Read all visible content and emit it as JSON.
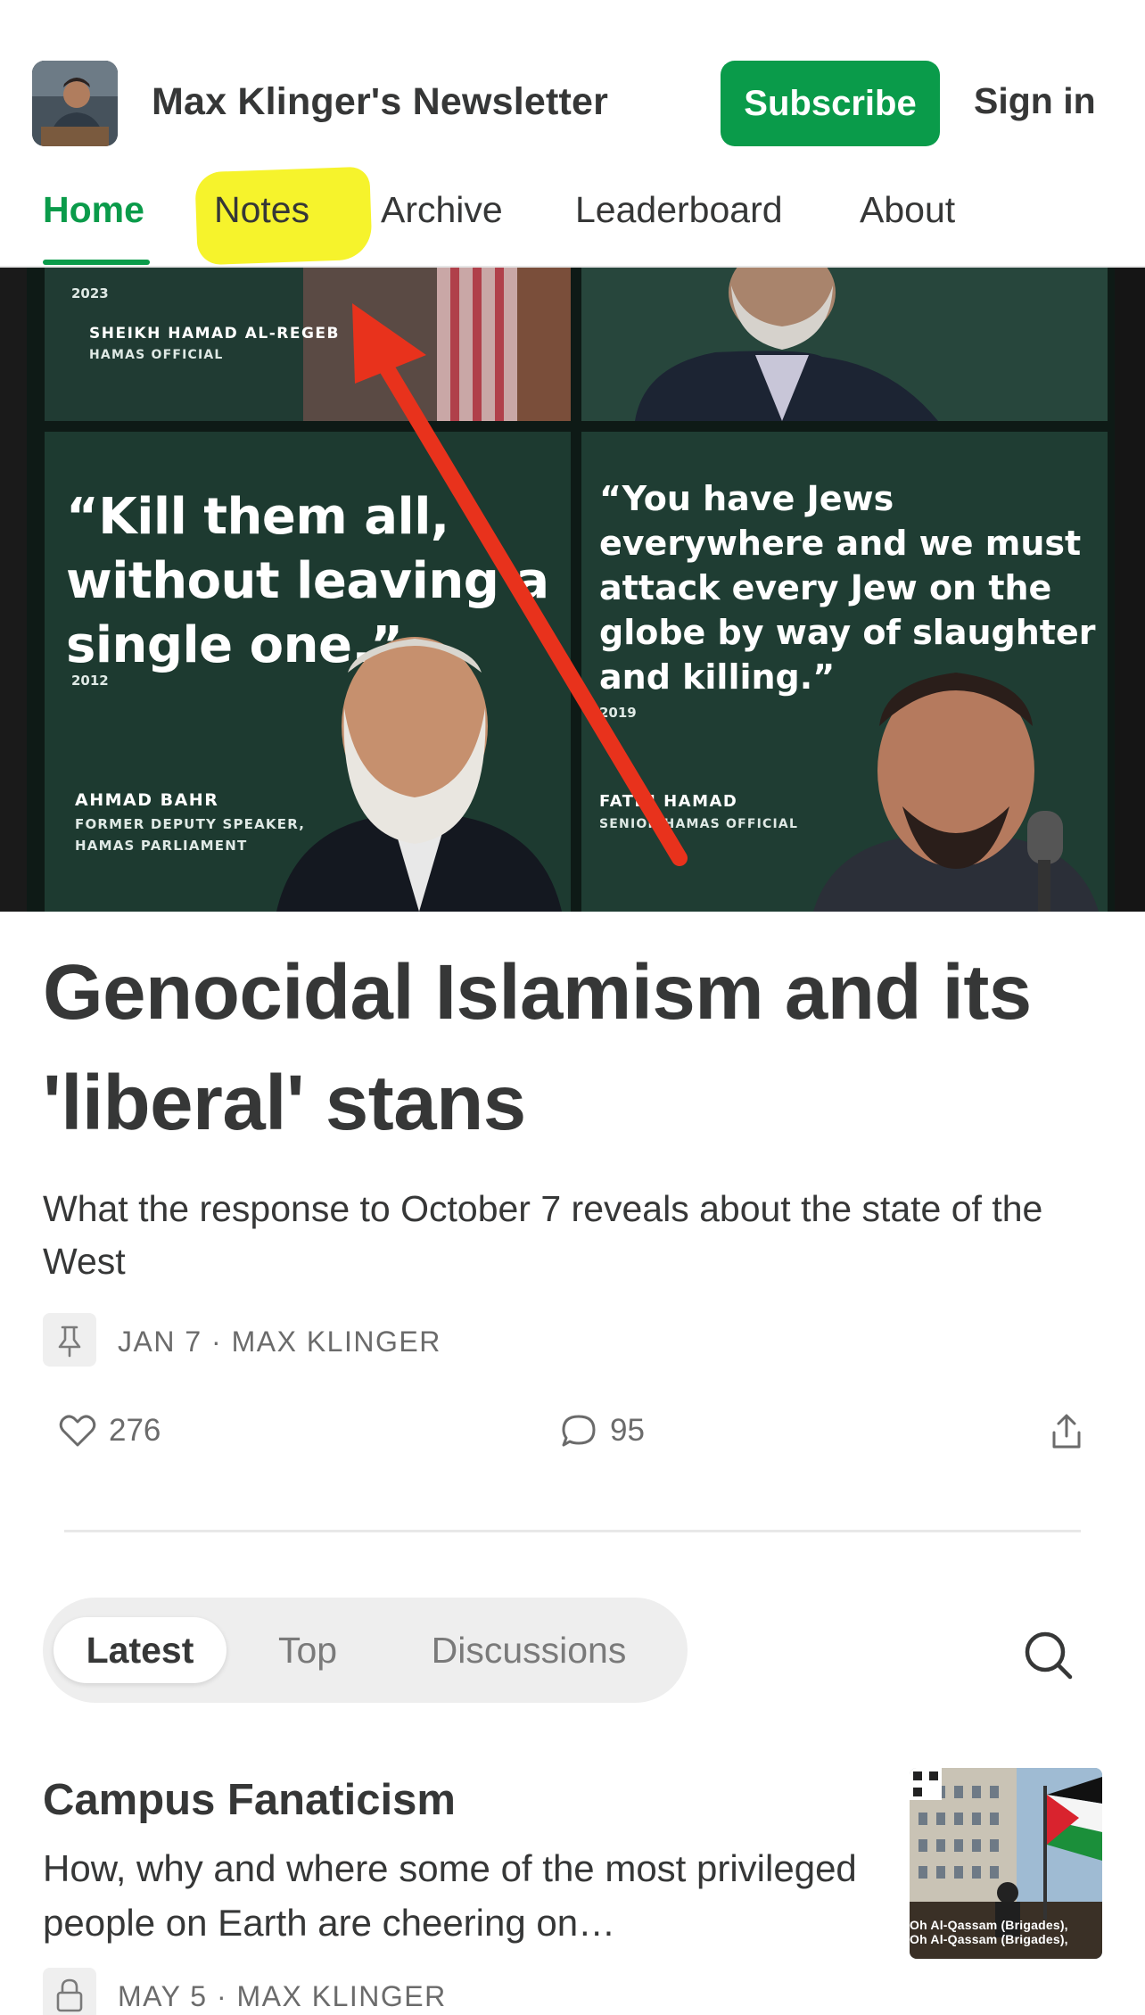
{
  "header": {
    "publication_name": "Max Klinger's Newsletter",
    "subscribe_label": "Subscribe",
    "signin_label": "Sign in"
  },
  "nav": {
    "items": [
      {
        "label": "Home",
        "active": true
      },
      {
        "label": "Notes",
        "active": false,
        "highlighted": true
      },
      {
        "label": "Archive",
        "active": false
      },
      {
        "label": "Leaderboard",
        "active": false
      },
      {
        "label": "About",
        "active": false
      }
    ]
  },
  "hero": {
    "top_left": {
      "year": "2023",
      "name": "SHEIKH HAMAD AL-REGEB",
      "role": "HAMAS OFFICIAL"
    },
    "bottom_left": {
      "quote_lines": [
        "“Kill them all,",
        "without leaving a",
        "single one.”"
      ],
      "year": "2012",
      "name": "AHMAD BAHR",
      "role_lines": [
        "FORMER DEPUTY SPEAKER,",
        "HAMAS PARLIAMENT"
      ]
    },
    "bottom_right": {
      "quote_lines": [
        "“You have Jews",
        "everywhere and we must",
        "attack every Jew on the",
        "globe by way of slaughter",
        "and killing.”"
      ],
      "year": "2019",
      "name": "FATHI HAMAD",
      "role": "SENIOR HAMAS OFFICIAL"
    }
  },
  "article": {
    "title_line1": "Genocidal Islamism and its",
    "title_line2": "'liberal' stans",
    "subtitle": "What the response to October 7 reveals about the state of the West",
    "meta": "JAN 7 · MAX KLINGER",
    "likes": "276",
    "comments": "95"
  },
  "tabs": {
    "items": [
      "Latest",
      "Top",
      "Discussions"
    ],
    "active": "Latest"
  },
  "post": {
    "title": "Campus Fanaticism",
    "description": "How, why and where some of the most privileged people on Earth are cheering on…",
    "meta": "MAY 5 · MAX KLINGER",
    "thumb_caption_1": "Oh Al-Qassam (Brigades),",
    "thumb_caption_2": "Oh Al-Qassam (Brigades),"
  },
  "colors": {
    "brand_green": "#0a9b4a",
    "highlight_yellow": "#f5f21a",
    "arrow_red": "#e8321c",
    "hero_panel_green": "#1f3d33"
  },
  "icons": [
    "pin-icon",
    "heart-icon",
    "comment-icon",
    "share-icon",
    "search-icon",
    "lock-icon",
    "arrow-annotation"
  ]
}
